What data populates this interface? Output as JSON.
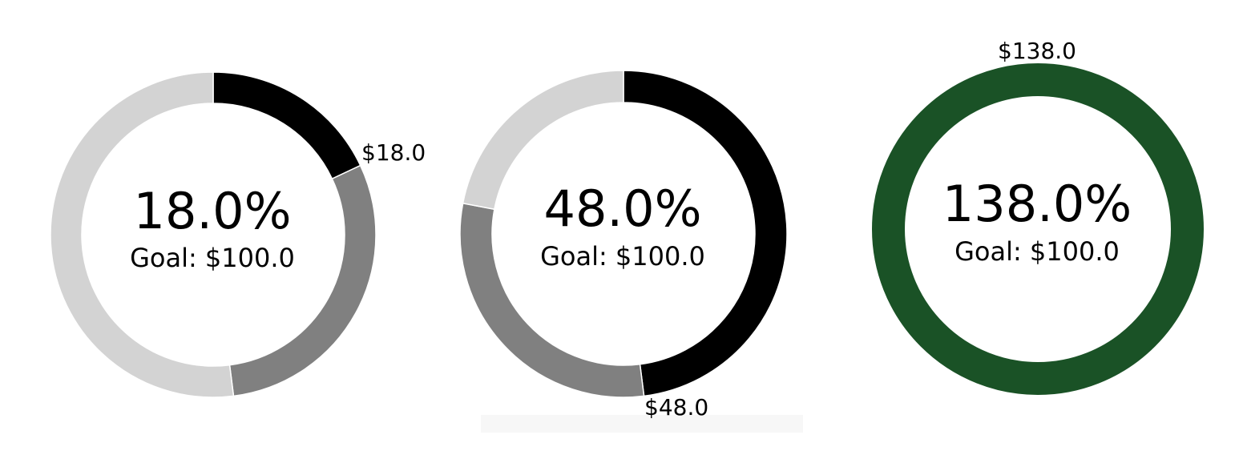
{
  "chart_data": [
    {
      "type": "pie",
      "style": "donut",
      "value": 18.0,
      "goal": 100.0,
      "percent_label": "18.0%",
      "goal_label": "Goal: $100.0",
      "value_label": "$18.0",
      "segments": [
        {
          "value": 18.0,
          "color": "#000000"
        },
        {
          "value": 30.0,
          "color": "#808080"
        },
        {
          "value": 52.0,
          "color": "#d3d3d3"
        }
      ]
    },
    {
      "type": "pie",
      "style": "donut",
      "value": 48.0,
      "goal": 100.0,
      "percent_label": "48.0%",
      "goal_label": "Goal: $100.0",
      "value_label": "$48.0",
      "segments": [
        {
          "value": 48.0,
          "color": "#000000"
        },
        {
          "value": 30.0,
          "color": "#808080"
        },
        {
          "value": 22.0,
          "color": "#d3d3d3"
        }
      ]
    },
    {
      "type": "pie",
      "style": "donut",
      "value": 138.0,
      "goal": 100.0,
      "percent_label": "138.0%",
      "goal_label": "Goal: $100.0",
      "value_label": "$138.0",
      "segments": [
        {
          "value": 100.0,
          "color": "#1a5226"
        }
      ]
    }
  ]
}
